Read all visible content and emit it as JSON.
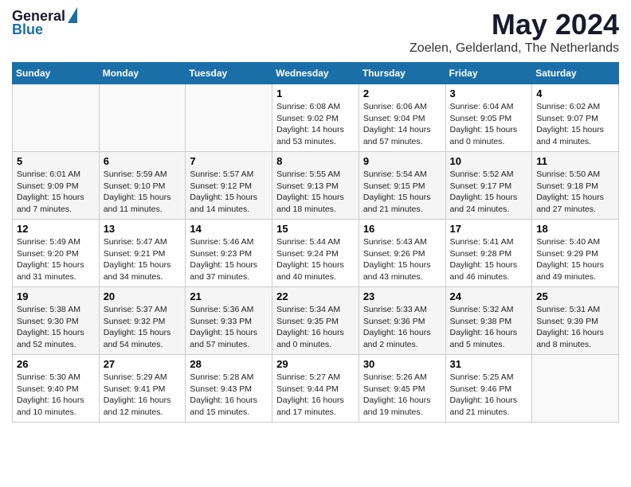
{
  "header": {
    "logo_general": "General",
    "logo_blue": "Blue",
    "title": "May 2024",
    "subtitle": "Zoelen, Gelderland, The Netherlands"
  },
  "columns": [
    "Sunday",
    "Monday",
    "Tuesday",
    "Wednesday",
    "Thursday",
    "Friday",
    "Saturday"
  ],
  "weeks": [
    [
      {
        "day": "",
        "info": ""
      },
      {
        "day": "",
        "info": ""
      },
      {
        "day": "",
        "info": ""
      },
      {
        "day": "1",
        "info": "Sunrise: 6:08 AM\nSunset: 9:02 PM\nDaylight: 14 hours\nand 53 minutes."
      },
      {
        "day": "2",
        "info": "Sunrise: 6:06 AM\nSunset: 9:04 PM\nDaylight: 14 hours\nand 57 minutes."
      },
      {
        "day": "3",
        "info": "Sunrise: 6:04 AM\nSunset: 9:05 PM\nDaylight: 15 hours\nand 0 minutes."
      },
      {
        "day": "4",
        "info": "Sunrise: 6:02 AM\nSunset: 9:07 PM\nDaylight: 15 hours\nand 4 minutes."
      }
    ],
    [
      {
        "day": "5",
        "info": "Sunrise: 6:01 AM\nSunset: 9:09 PM\nDaylight: 15 hours\nand 7 minutes."
      },
      {
        "day": "6",
        "info": "Sunrise: 5:59 AM\nSunset: 9:10 PM\nDaylight: 15 hours\nand 11 minutes."
      },
      {
        "day": "7",
        "info": "Sunrise: 5:57 AM\nSunset: 9:12 PM\nDaylight: 15 hours\nand 14 minutes."
      },
      {
        "day": "8",
        "info": "Sunrise: 5:55 AM\nSunset: 9:13 PM\nDaylight: 15 hours\nand 18 minutes."
      },
      {
        "day": "9",
        "info": "Sunrise: 5:54 AM\nSunset: 9:15 PM\nDaylight: 15 hours\nand 21 minutes."
      },
      {
        "day": "10",
        "info": "Sunrise: 5:52 AM\nSunset: 9:17 PM\nDaylight: 15 hours\nand 24 minutes."
      },
      {
        "day": "11",
        "info": "Sunrise: 5:50 AM\nSunset: 9:18 PM\nDaylight: 15 hours\nand 27 minutes."
      }
    ],
    [
      {
        "day": "12",
        "info": "Sunrise: 5:49 AM\nSunset: 9:20 PM\nDaylight: 15 hours\nand 31 minutes."
      },
      {
        "day": "13",
        "info": "Sunrise: 5:47 AM\nSunset: 9:21 PM\nDaylight: 15 hours\nand 34 minutes."
      },
      {
        "day": "14",
        "info": "Sunrise: 5:46 AM\nSunset: 9:23 PM\nDaylight: 15 hours\nand 37 minutes."
      },
      {
        "day": "15",
        "info": "Sunrise: 5:44 AM\nSunset: 9:24 PM\nDaylight: 15 hours\nand 40 minutes."
      },
      {
        "day": "16",
        "info": "Sunrise: 5:43 AM\nSunset: 9:26 PM\nDaylight: 15 hours\nand 43 minutes."
      },
      {
        "day": "17",
        "info": "Sunrise: 5:41 AM\nSunset: 9:28 PM\nDaylight: 15 hours\nand 46 minutes."
      },
      {
        "day": "18",
        "info": "Sunrise: 5:40 AM\nSunset: 9:29 PM\nDaylight: 15 hours\nand 49 minutes."
      }
    ],
    [
      {
        "day": "19",
        "info": "Sunrise: 5:38 AM\nSunset: 9:30 PM\nDaylight: 15 hours\nand 52 minutes."
      },
      {
        "day": "20",
        "info": "Sunrise: 5:37 AM\nSunset: 9:32 PM\nDaylight: 15 hours\nand 54 minutes."
      },
      {
        "day": "21",
        "info": "Sunrise: 5:36 AM\nSunset: 9:33 PM\nDaylight: 15 hours\nand 57 minutes."
      },
      {
        "day": "22",
        "info": "Sunrise: 5:34 AM\nSunset: 9:35 PM\nDaylight: 16 hours\nand 0 minutes."
      },
      {
        "day": "23",
        "info": "Sunrise: 5:33 AM\nSunset: 9:36 PM\nDaylight: 16 hours\nand 2 minutes."
      },
      {
        "day": "24",
        "info": "Sunrise: 5:32 AM\nSunset: 9:38 PM\nDaylight: 16 hours\nand 5 minutes."
      },
      {
        "day": "25",
        "info": "Sunrise: 5:31 AM\nSunset: 9:39 PM\nDaylight: 16 hours\nand 8 minutes."
      }
    ],
    [
      {
        "day": "26",
        "info": "Sunrise: 5:30 AM\nSunset: 9:40 PM\nDaylight: 16 hours\nand 10 minutes."
      },
      {
        "day": "27",
        "info": "Sunrise: 5:29 AM\nSunset: 9:41 PM\nDaylight: 16 hours\nand 12 minutes."
      },
      {
        "day": "28",
        "info": "Sunrise: 5:28 AM\nSunset: 9:43 PM\nDaylight: 16 hours\nand 15 minutes."
      },
      {
        "day": "29",
        "info": "Sunrise: 5:27 AM\nSunset: 9:44 PM\nDaylight: 16 hours\nand 17 minutes."
      },
      {
        "day": "30",
        "info": "Sunrise: 5:26 AM\nSunset: 9:45 PM\nDaylight: 16 hours\nand 19 minutes."
      },
      {
        "day": "31",
        "info": "Sunrise: 5:25 AM\nSunset: 9:46 PM\nDaylight: 16 hours\nand 21 minutes."
      },
      {
        "day": "",
        "info": ""
      }
    ]
  ]
}
